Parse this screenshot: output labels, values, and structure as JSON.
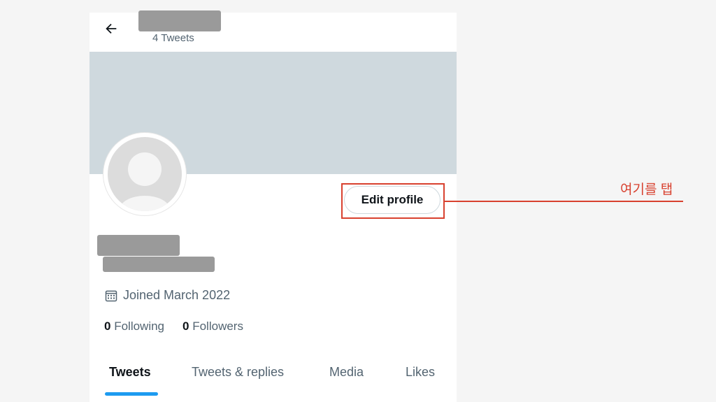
{
  "header": {
    "tweets_count": "4 Tweets"
  },
  "profile": {
    "edit_button_label": "Edit profile",
    "joined": "Joined March 2022",
    "following_count": "0",
    "following_label": "Following",
    "followers_count": "0",
    "followers_label": "Followers"
  },
  "tabs": [
    {
      "label": "Tweets"
    },
    {
      "label": "Tweets & replies"
    },
    {
      "label": "Media"
    },
    {
      "label": "Likes"
    }
  ],
  "annotation": {
    "callout_text": "여기를 탭"
  },
  "colors": {
    "accent": "#1d9bf0",
    "annotation": "#d8412f",
    "banner": "#cfd9de"
  },
  "icons": [
    "back-arrow-icon",
    "calendar-icon",
    "default-avatar-icon"
  ]
}
